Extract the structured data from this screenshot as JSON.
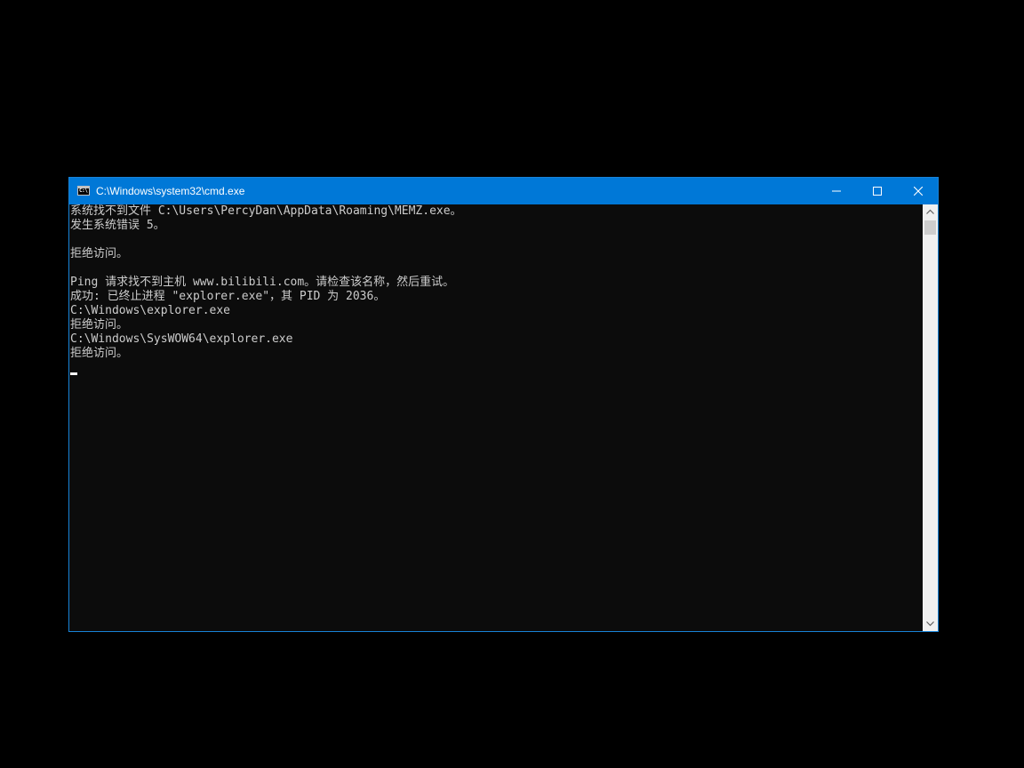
{
  "window": {
    "title": "C:\\Windows\\system32\\cmd.exe",
    "icon_text": "C:\\",
    "controls": {
      "minimize": "minimize-icon",
      "maximize": "maximize-icon",
      "close": "close-icon"
    }
  },
  "console": {
    "lines": [
      "系统找不到文件 C:\\Users\\PercyDan\\AppData\\Roaming\\MEMZ.exe。",
      "发生系统错误 5。",
      "",
      "拒绝访问。",
      "",
      "Ping 请求找不到主机 www.bilibili.com。请检查该名称，然后重试。",
      "成功: 已终止进程 \"explorer.exe\"，其 PID 为 2036。",
      "C:\\Windows\\explorer.exe",
      "拒绝访问。",
      "C:\\Windows\\SysWOW64\\explorer.exe",
      "拒绝访问。"
    ]
  },
  "colors": {
    "titlebar": "#0078d7",
    "console_bg": "#0c0c0c",
    "console_text": "#cccccc",
    "scrollbar_bg": "#f0f0f0",
    "scrollbar_thumb": "#cdcdcd"
  },
  "scrollbar": {
    "up_icon": "chevron-up-icon",
    "down_icon": "chevron-down-icon"
  }
}
